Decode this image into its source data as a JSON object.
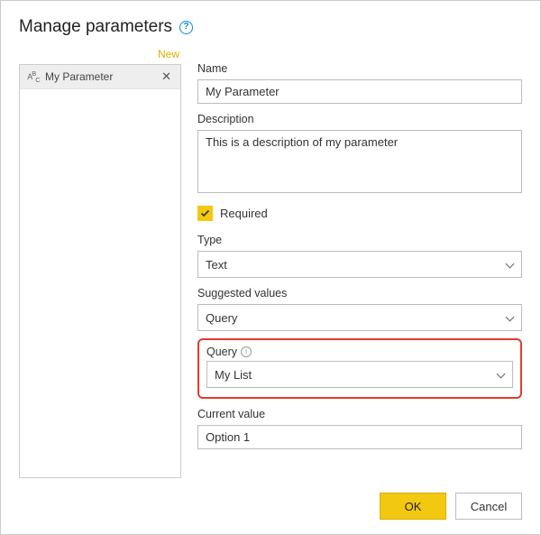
{
  "header": {
    "title": "Manage parameters"
  },
  "sidebar": {
    "new_link": "New",
    "items": [
      {
        "label": "My Parameter"
      }
    ]
  },
  "form": {
    "name_label": "Name",
    "name_value": "My Parameter",
    "description_label": "Description",
    "description_value": "This is a description of my parameter",
    "required_label": "Required",
    "required_checked": true,
    "type_label": "Type",
    "type_value": "Text",
    "suggested_label": "Suggested values",
    "suggested_value": "Query",
    "query_label": "Query",
    "query_value": "My List",
    "current_label": "Current value",
    "current_value": "Option 1"
  },
  "footer": {
    "ok": "OK",
    "cancel": "Cancel"
  }
}
